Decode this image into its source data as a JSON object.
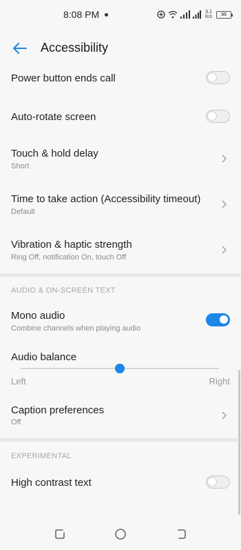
{
  "status": {
    "time": "8:08 PM",
    "speed_top": "3.1",
    "speed_bottom": "K/s",
    "battery": "98"
  },
  "header": {
    "title": "Accessibility"
  },
  "settings": {
    "power_button": {
      "title": "Power button ends call",
      "enabled": false
    },
    "auto_rotate": {
      "title": "Auto-rotate screen",
      "enabled": false
    },
    "touch_hold": {
      "title": "Touch & hold delay",
      "subtitle": "Short"
    },
    "time_action": {
      "title": "Time to take action (Accessibility timeout)",
      "subtitle": "Default"
    },
    "vibration": {
      "title": "Vibration & haptic strength",
      "subtitle": "Ring Off, notification On, touch Off"
    }
  },
  "audio": {
    "section_header": "AUDIO & ON-SCREEN TEXT",
    "mono": {
      "title": "Mono audio",
      "subtitle": "Combine channels when playing audio",
      "enabled": true
    },
    "balance": {
      "title": "Audio balance",
      "left_label": "Left",
      "right_label": "Right",
      "value": 0.5
    },
    "captions": {
      "title": "Caption preferences",
      "subtitle": "Off"
    }
  },
  "experimental": {
    "section_header": "EXPERIMENTAL",
    "high_contrast": {
      "title": "High contrast text",
      "enabled": false
    }
  },
  "colors": {
    "accent": "#1a86e8",
    "background": "#f7f7f7",
    "divider": "#e8e8e8"
  }
}
